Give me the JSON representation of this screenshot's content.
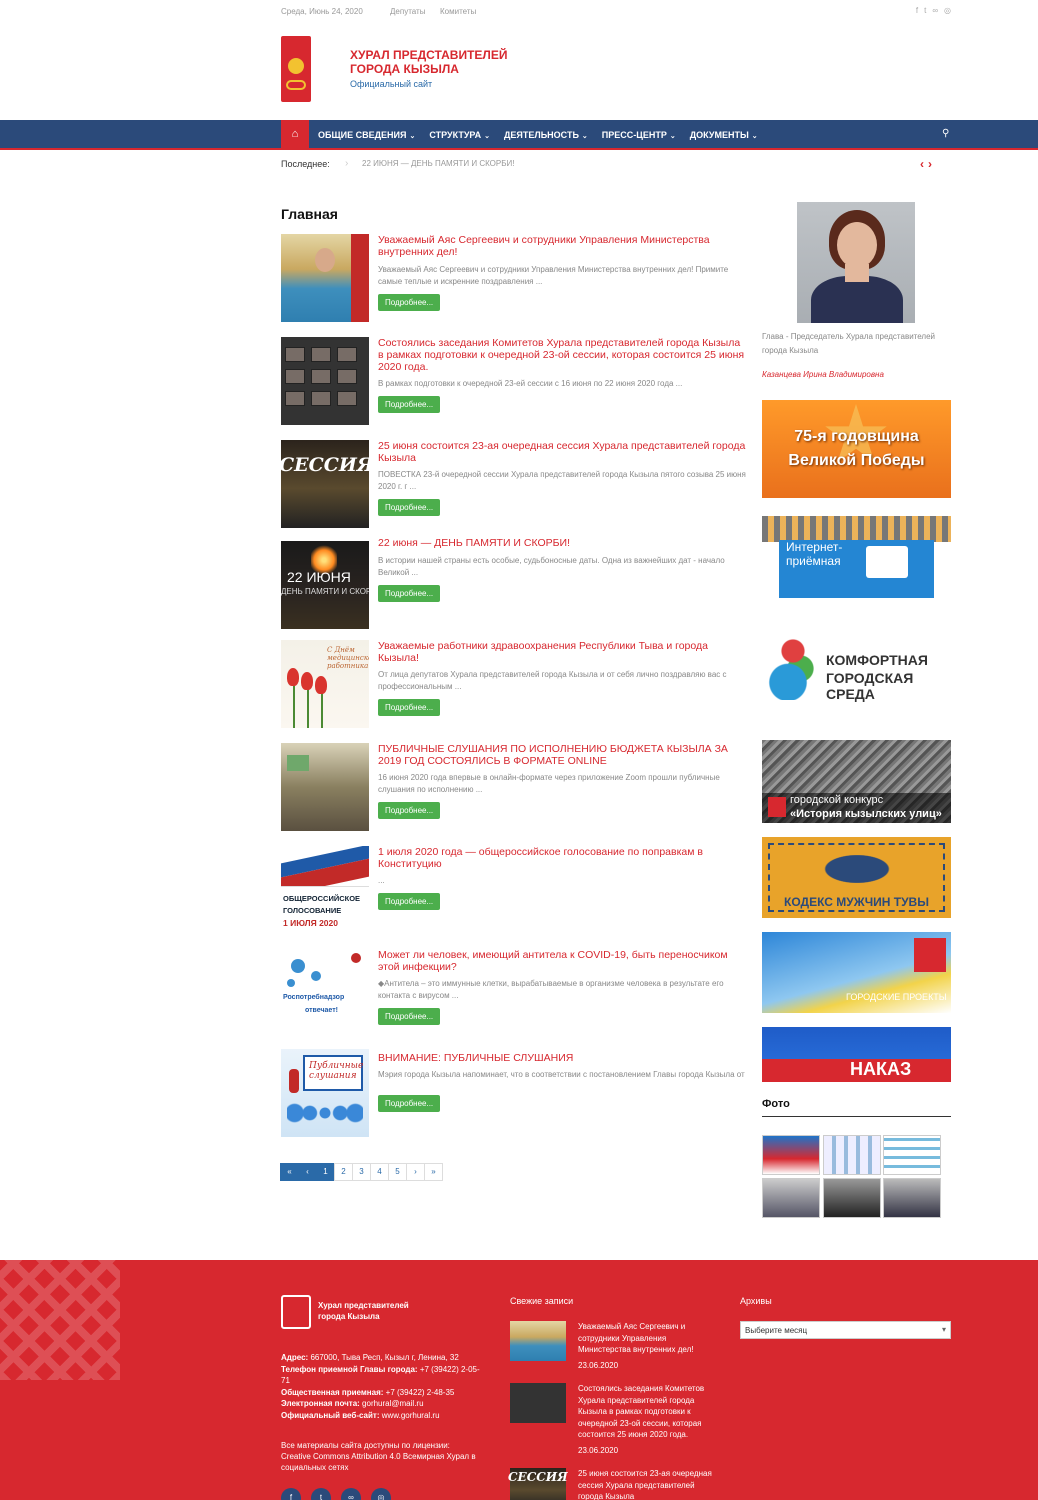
{
  "topbar": {
    "date": "Среда, Июнь 24, 2020",
    "links": [
      "Депутаты",
      "Комитеты"
    ],
    "social_icons": [
      "facebook-icon",
      "twitter-icon",
      "link-icon",
      "instagram-icon"
    ]
  },
  "header": {
    "title_line1": "ХУРАЛ ПРЕДСТАВИТЕЛЕЙ",
    "title_line2": "ГОРОДА КЫЗЫЛА",
    "subtitle": "Официальный сайт"
  },
  "nav": {
    "items": [
      "ОБЩИЕ СВЕДЕНИЯ",
      "СТРУКТУРА",
      "ДЕЯТЕЛЬНОСТЬ",
      "ПРЕСС-ЦЕНТР",
      "ДОКУМЕНТЫ"
    ],
    "home_icon": "home-icon",
    "search_icon": "search-icon"
  },
  "latest": {
    "label": "Последнее:",
    "text": "22 ИЮНЯ — ДЕНЬ ПАМЯТИ И СКОРБИ!"
  },
  "page_title": "Главная",
  "more_label": "Подробнее...",
  "posts": [
    {
      "title": "Уважаемый Аяс Сергеевич и сотрудники Управления Министерства внутренних дел!",
      "excerpt": "Уважаемый Аяс Сергеевич и сотрудники Управления Министерства внутренних дел! Примите самые теплые и искренние поздравления ..."
    },
    {
      "title": "Состоялись заседания Комитетов Хурала представителей города Кызыла в рамках подготовки к очередной 23-ой сессии, которая состоится 25 июня 2020 года.",
      "excerpt": "В рамках подготовки к очередной 23-ей сессии с 16 июня по 22 июня 2020 года ..."
    },
    {
      "title": "25 июня состоится 23-ая очередная сессия Хурала представителей города Кызыла",
      "excerpt": "ПОВЕСТКА 23-й очередной сессии Хурала представителей города Кызыла пятого созыва 25 июня 2020 г. г ..."
    },
    {
      "title": "22 июня — ДЕНЬ ПАМЯТИ И СКОРБИ!",
      "excerpt": "В истории нашей страны есть особые, судьбоносные даты. Одна из важнейших дат - начало Великой ..."
    },
    {
      "title": "Уважаемые работники здравоохранения Республики Тыва и города Кызыла!",
      "excerpt": "От лица депутатов Хурала представителей города Кызыла и от себя лично поздравляю вас с профессиональным ..."
    },
    {
      "title": "ПУБЛИЧНЫЕ СЛУШАНИЯ ПО ИСПОЛНЕНИЮ БЮДЖЕТА КЫЗЫЛА ЗА 2019 ГОД СОСТОЯЛИСЬ В ФОРМАТЕ ONLINE",
      "excerpt": "16 июня 2020 года впервые в онлайн-формате через приложение Zoom прошли публичные слушания по исполнению ..."
    },
    {
      "title": "1 июля 2020 года — общероссийское голосование по поправкам в Конституцию",
      "excerpt": "..."
    },
    {
      "title": "Может ли человек, имеющий антитела к COVID-19, быть переносчиком этой инфекции?",
      "excerpt": "◆Антитела – это иммунные клетки, вырабатываемые в организме человека в результате его контакта с вирусом ..."
    },
    {
      "title": "ВНИМАНИЕ: ПУБЛИЧНЫЕ СЛУШАНИЯ",
      "excerpt": "Мэрия города Кызыла напоминает, что в соответствии с постановлением Главы города Кызыла от 05 июня ..."
    }
  ],
  "thumb_text": {
    "t3": "СЕССИЯ",
    "t4_big": "22 ИЮНЯ",
    "t4_small": "ДЕНЬ ПАМЯТИ И СКОРБИ",
    "t5": "С Днём медицинского работника",
    "t7_1": "ОБЩЕРОССИЙСКОЕ",
    "t7_2": "ГОЛОСОВАНИЕ",
    "t7_3": "1 ИЮЛЯ 2020",
    "t8_1": "Роспотребнадзор",
    "t8_2": "отвечает!",
    "t9": "Публичные слушания"
  },
  "pager": [
    "«",
    "‹",
    "1",
    "2",
    "3",
    "4",
    "5",
    "›",
    "»"
  ],
  "sidebar": {
    "caption": "Глава - Председатель Хурала представителей города Кызыла",
    "name": "Казанцева Ирина Владимировна",
    "banner1_l1": "75-я годовщина",
    "banner1_l2": "Великой Победы",
    "banner2_l1": "Интернет-",
    "banner2_l2": "приёмная",
    "banner3_l1": "КОМФОРТНАЯ",
    "banner3_l2": "ГОРОДСКАЯ СРЕДА",
    "banner4_l1": "городской конкурс",
    "banner4_l2": "«История кызылских улиц»",
    "banner5": "КОДЕКС МУЖЧИН ТУВЫ",
    "banner6": "ГОРОДСКИЕ ПРОЕКТЫ",
    "banner7": "НАКАЗ",
    "photo_title": "Фото"
  },
  "footer": {
    "org_name": "Хурал представителей города Кызыла",
    "address_label": "Адрес:",
    "address": "667000, Тыва Респ, Кызыл г, Ленина, 32",
    "phone_label": "Телефон приемной Главы города:",
    "phone": "+7 (39422) 2-05-71",
    "public_label": "Общественная приемная:",
    "public_phone": "+7 (39422) 2-48-35",
    "email_label": "Электронная почта:",
    "email": "gorhural@mail.ru",
    "site_label": "Официальный веб-сайт:",
    "site": "www.gorhural.ru",
    "license": "Все материалы сайта доступны по лицензии: Creative Commons Attribution 4.0 Всемирная Хурал в социальных сетях",
    "recent_title": "Свежие записи",
    "recent": [
      {
        "title": "Уважаемый Аяс Сергеевич и сотрудники Управления Министерства внутренних дел!",
        "date": "23.06.2020"
      },
      {
        "title": "Состоялись заседания Комитетов Хурала представителей города Кызыла в рамках подготовки к очередной 23-ой сессии, которая состоится 25 июня 2020 года.",
        "date": "23.06.2020"
      },
      {
        "title": "25 июня состоится 23-ая очередная сессия Хурала представителей города Кызыла",
        "date": ""
      }
    ],
    "archive_title": "Архивы",
    "archive_placeholder": "Выберите месяц"
  }
}
